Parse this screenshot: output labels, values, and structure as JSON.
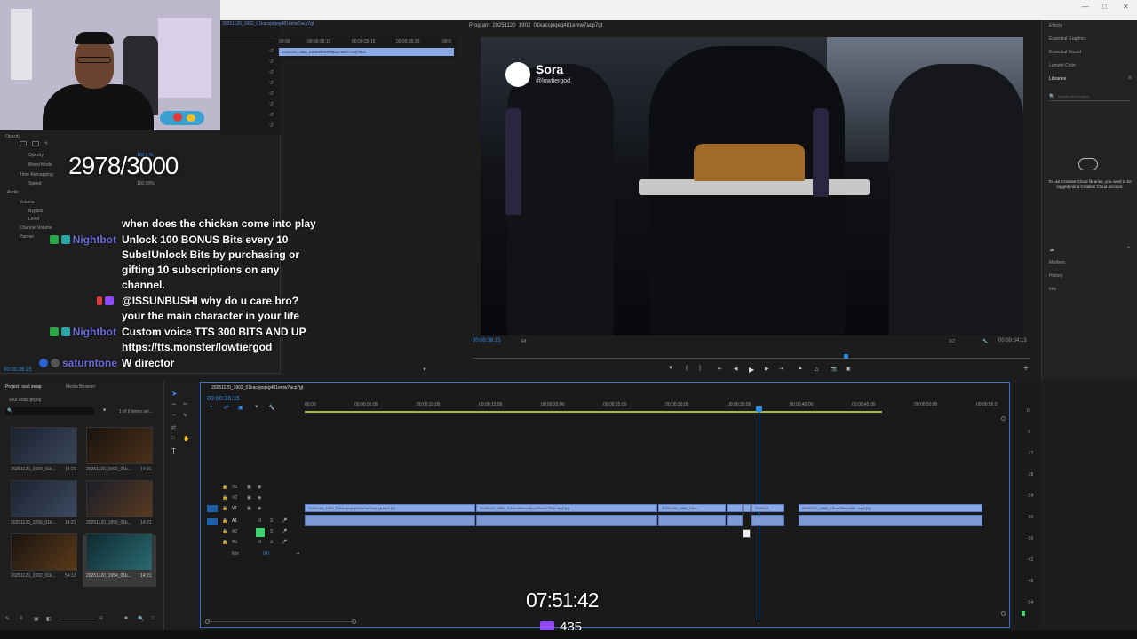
{
  "overlay": {
    "sub_goal": "2978/3000",
    "stream_time": "07:51:42",
    "viewer_count": "435"
  },
  "chat": [
    {
      "user": "",
      "message": "when does the chicken come into play",
      "user_color": "#2a2bd8"
    },
    {
      "user": "Nightbot",
      "message": "Unlock 100 BONUS Bits every 10",
      "user_color": "#6a6ad8"
    },
    {
      "user": "",
      "message": "Subs!Unlock Bits by purchasing or",
      "user_color": ""
    },
    {
      "user": "",
      "message": "gifting 10 subscriptions on any",
      "user_color": ""
    },
    {
      "user": "",
      "message": "channel.",
      "user_color": ""
    },
    {
      "user": "",
      "message": "@ISSUNBUSHI why do u care bro?",
      "user_color": "#2a2bd8"
    },
    {
      "user": "",
      "message": "your the main character in your life",
      "user_color": ""
    },
    {
      "user": "Nightbot",
      "message": "Custom voice TTS 300 BITS AND UP",
      "user_color": "#6a6ad8"
    },
    {
      "user": "",
      "message": "https://tts.monster/lowtiergod",
      "user_color": ""
    },
    {
      "user": "saturntone",
      "message": "W director",
      "user_color": "#6a6ad8"
    }
  ],
  "source": {
    "clip_name": "20251120_1902_01kacsjoqeg481emw7acp7gt",
    "times": [
      "00:00",
      "00:00:35:10",
      "00:00:35:15",
      "00:00:35:20",
      "00:0"
    ],
    "clip_label": "20251120_1856_01kahr5k9mvbfpq47kmh7754p.mp4"
  },
  "effects": {
    "opacity": "Opacity",
    "opacity_sub": "Opacity",
    "opacity_val": "100.0 %",
    "blend": "Blend Mode",
    "time_remap": "Time Remapping",
    "speed": "Speed",
    "speed_val": "100.00%",
    "audio": "Audio",
    "volume": "Volume",
    "bypass": "Bypass",
    "level": "Level",
    "channel_volume": "Channel Volume",
    "panner": "Panner"
  },
  "program": {
    "title": "Program: 20251120_1902_01kacsjoqeg481emw7acp7gt",
    "timecode": "00:00:36:15",
    "fit": "Fit",
    "fraction": "1/2",
    "duration": "00:00:54:13",
    "watermark_name": "Sora",
    "watermark_handle": "@lowtiergod"
  },
  "right_panel": {
    "items": [
      "Effects",
      "Essential Graphics",
      "Essential Sound",
      "Lumetri Color",
      "Libraries"
    ],
    "search": "Search All Libraries",
    "cc_message": "To use Creative Cloud libraries, you need to be logged into a Creative Cloud account.",
    "bottom_items": [
      "Markers",
      "History",
      "Info"
    ]
  },
  "project": {
    "tab1": "Project: soul swap",
    "tab2": "Media Browser",
    "file": "soul swap.prproj",
    "count": "1 of 6 items sel...",
    "items": [
      {
        "name": "20251120_1900_01k...",
        "dur": "14:21"
      },
      {
        "name": "20251120_1902_01k...",
        "dur": "14:21"
      },
      {
        "name": "20251120_1856_01k...",
        "dur": "14:21"
      },
      {
        "name": "20251120_1856_01k...",
        "dur": "14:21"
      },
      {
        "name": "20251120_1902_01k...",
        "dur": "54:13"
      },
      {
        "name": "20251120_1954_01k...",
        "dur": "14:21"
      }
    ]
  },
  "timeline": {
    "tab": "20251120_1902_01kacsjoqeg481emw7acp7gt",
    "timecode": "00:00:36:15",
    "ruler": [
      "00:00",
      "00:00:05:00",
      "00:00:10:00",
      "00:00:15:00",
      "00:00:20:00",
      "00:00:25:00",
      "00:00:30:00",
      "00:00:35:00",
      "00:00:40:00",
      "00:00:45:00",
      "00:00:50:00",
      "00:00:55:0"
    ],
    "tracks": [
      "V3",
      "V2",
      "V1",
      "A1",
      "A2",
      "A3",
      "Mix"
    ],
    "mix_val": "0.0",
    "clips": [
      "20251120_1902_01kacsjoqeg481emw7acp7gt.mp4 [V]",
      "20251120_1856_01kahr5k9mvbfpq47kmh7754p.mp4 [V]",
      "20251120_1954_01ka...",
      "2025112...",
      "20251120_1956_01kas78ekrw8j6...mp4 [V]"
    ],
    "meter_scale": [
      "0",
      "-6",
      "-12",
      "-18",
      "-24",
      "-30",
      "-36",
      "-42",
      "-48",
      "-54"
    ]
  },
  "colors": {
    "accent_blue": "#2d8ceb",
    "clip_blue": "#8aa8e6",
    "panel_bg": "#1e1e1e",
    "twitch_purple": "#9146ff"
  }
}
